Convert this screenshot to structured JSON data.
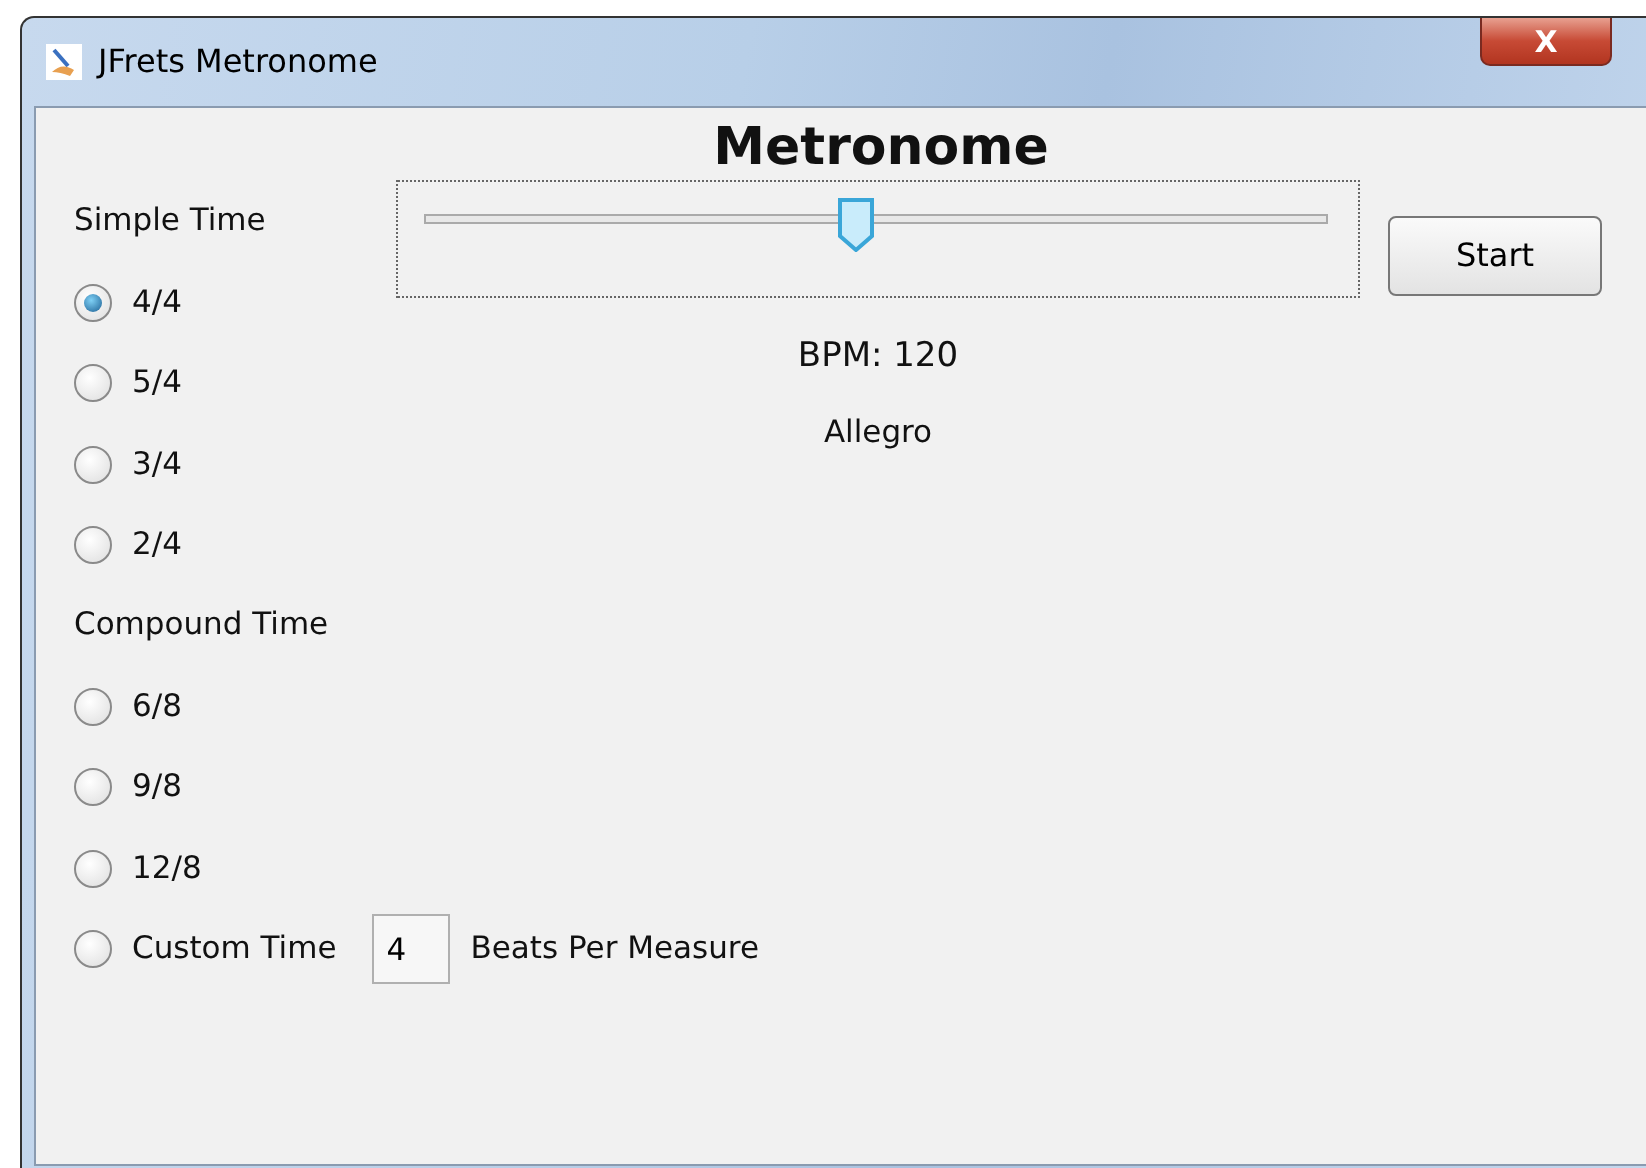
{
  "window": {
    "title": "JFrets Metronome",
    "close": "X"
  },
  "heading": "Metronome",
  "groups": [
    {
      "title": "Simple Time",
      "options": [
        {
          "kind": "radio",
          "label": "4/4",
          "selected": true
        },
        {
          "kind": "radio",
          "label": "5/4",
          "selected": false
        },
        {
          "kind": "radio",
          "label": "3/4",
          "selected": false
        },
        {
          "kind": "radio",
          "label": "2/4",
          "selected": false
        }
      ]
    },
    {
      "title": "Compound Time",
      "options": [
        {
          "kind": "radio",
          "label": "6/8",
          "selected": false
        },
        {
          "kind": "radio",
          "label": "9/8",
          "selected": false
        },
        {
          "kind": "radio",
          "label": "12/8",
          "selected": false
        },
        {
          "kind": "custom",
          "label": "Custom Time",
          "selected": false,
          "value": "4",
          "suffix": "Beats Per Measure"
        }
      ]
    }
  ],
  "tempo": {
    "level": 0.477,
    "bpm": "BPM: 120",
    "name": "Allegro"
  },
  "start_button": "Start"
}
